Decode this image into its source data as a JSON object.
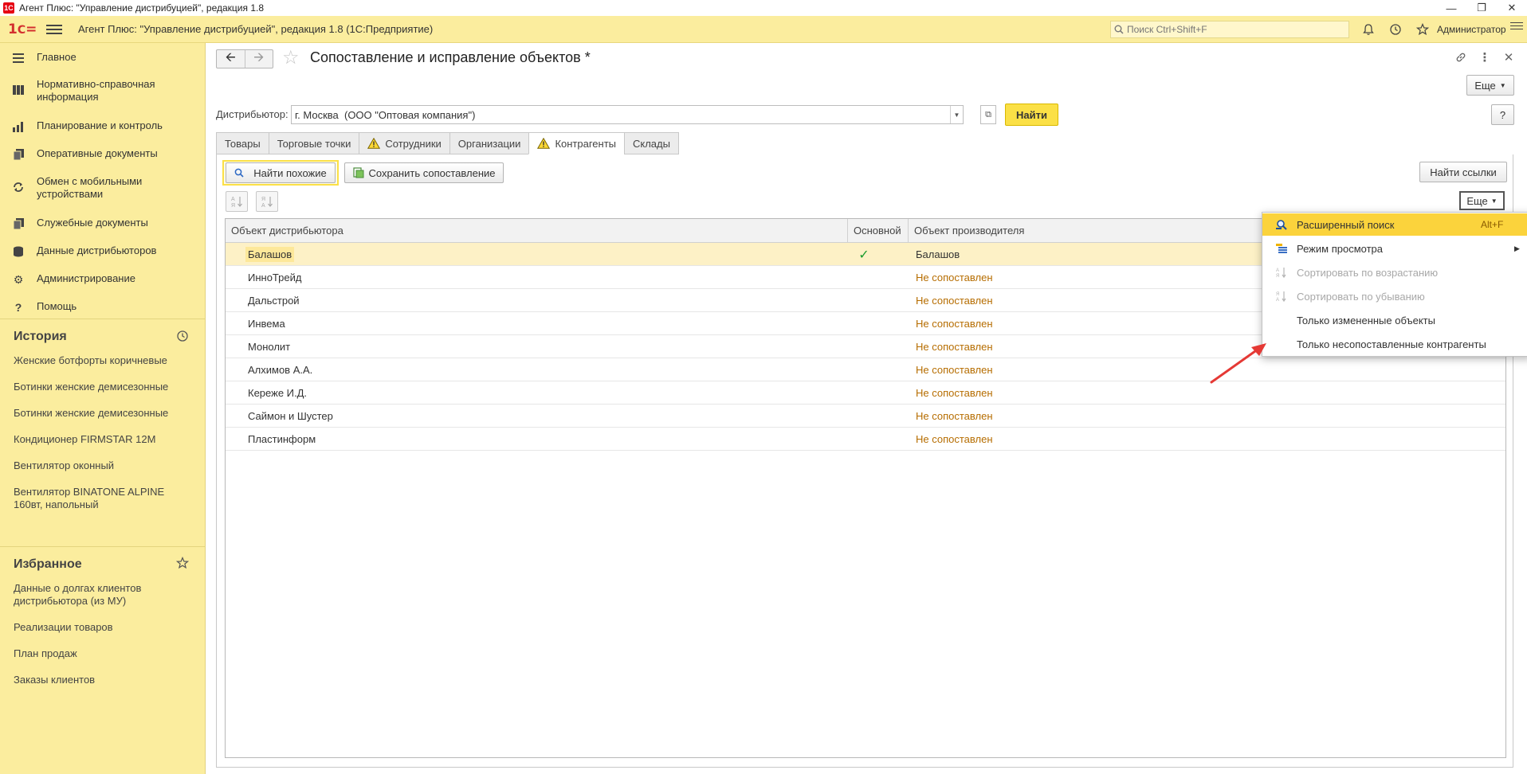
{
  "window": {
    "title": "Агент Плюс: \"Управление дистрибуцией\", редакция 1.8",
    "logo": "1С"
  },
  "appbar": {
    "title": "Агент Плюс: \"Управление дистрибуцией\", редакция 1.8  (1С:Предприятие)",
    "search_placeholder": "Поиск Ctrl+Shift+F",
    "user": "Администратор"
  },
  "sidebar": {
    "nav": [
      {
        "label": "Главное",
        "icon": "menu-icon"
      },
      {
        "label": "Нормативно-справочная информация",
        "icon": "reference-icon"
      },
      {
        "label": "Планирование и контроль",
        "icon": "chart-icon"
      },
      {
        "label": "Оперативные документы",
        "icon": "documents-icon"
      },
      {
        "label": "Обмен с мобильными устройствами",
        "icon": "sync-icon"
      },
      {
        "label": "Служебные документы",
        "icon": "service-documents-icon"
      },
      {
        "label": "Данные дистрибьюторов",
        "icon": "distributor-data-icon"
      },
      {
        "label": "Администрирование",
        "icon": "gear-icon"
      },
      {
        "label": "Помощь",
        "icon": "help-icon"
      }
    ],
    "history_title": "История",
    "history": [
      "Женские ботфорты коричневые",
      "Ботинки женские демисезонные",
      "Ботинки женские демисезонные",
      "Кондиционер FIRMSTAR 12M",
      "Вентилятор оконный",
      "Вентилятор BINATONE ALPINE 160вт, напольный"
    ],
    "favorites_title": "Избранное",
    "favorites": [
      "Данные о долгах клиентов дистрибьютора (из МУ)",
      "Реализации товаров",
      "План продаж",
      "Заказы клиентов"
    ]
  },
  "form": {
    "title": "Сопоставление и исправление объектов *",
    "more_label": "Еще",
    "help_label": "?",
    "distributor_label": "Дистрибьютор:",
    "distributor_value": "г. Москва  (ООО \"Оптовая компания\")",
    "find_label": "Найти",
    "tabs": [
      {
        "label": "Товары",
        "warning": false
      },
      {
        "label": "Торговые точки",
        "warning": false
      },
      {
        "label": "Сотрудники",
        "warning": true
      },
      {
        "label": "Организации",
        "warning": false
      },
      {
        "label": "Контрагенты",
        "warning": true,
        "active": true
      },
      {
        "label": "Склады",
        "warning": false
      }
    ],
    "find_similar_label": "Найти похожие",
    "save_mapping_label": "Сохранить сопоставление",
    "find_links_label": "Найти ссылки",
    "table_more_label": "Еще"
  },
  "table": {
    "headers": [
      "Объект дистрибьютора",
      "Основной",
      "Объект производителя"
    ],
    "rows": [
      {
        "name": "Балашов",
        "main": "✓",
        "producer": "Балашов",
        "matched": true
      },
      {
        "name": "ИнноТрейд",
        "main": "",
        "producer": "Не сопоставлен",
        "matched": false
      },
      {
        "name": "Дальстрой",
        "main": "",
        "producer": "Не сопоставлен",
        "matched": false
      },
      {
        "name": "Инвема",
        "main": "",
        "producer": "Не сопоставлен",
        "matched": false
      },
      {
        "name": "Монолит",
        "main": "",
        "producer": "Не сопоставлен",
        "matched": false
      },
      {
        "name": "Алхимов А.А.",
        "main": "",
        "producer": "Не сопоставлен",
        "matched": false
      },
      {
        "name": "Кереже И.Д.",
        "main": "",
        "producer": "Не сопоставлен",
        "matched": false
      },
      {
        "name": "Саймон и Шустер",
        "main": "",
        "producer": "Не сопоставлен",
        "matched": false
      },
      {
        "name": "Пластинформ",
        "main": "",
        "producer": "Не сопоставлен",
        "matched": false
      }
    ]
  },
  "popup_menu": {
    "items": [
      {
        "label": "Расширенный поиск",
        "shortcut": "Alt+F",
        "state": "highlighted",
        "icon": "advanced-search-icon"
      },
      {
        "label": "Режим просмотра",
        "submenu": true,
        "icon": "view-mode-icon"
      },
      {
        "label": "Сортировать по возрастанию",
        "state": "disabled",
        "icon": "sort-ascending-icon"
      },
      {
        "label": "Сортировать по убыванию",
        "state": "disabled",
        "icon": "sort-descending-icon"
      },
      {
        "label": "Только измененные объекты"
      },
      {
        "label": "Только несопоставленные контрагенты"
      }
    ]
  },
  "colors": {
    "sidebar_bg": "#fbed9e",
    "accent_yellow": "#fbe046",
    "not_matched_text": "#b66d00",
    "annotation_arrow": "#e53935"
  }
}
